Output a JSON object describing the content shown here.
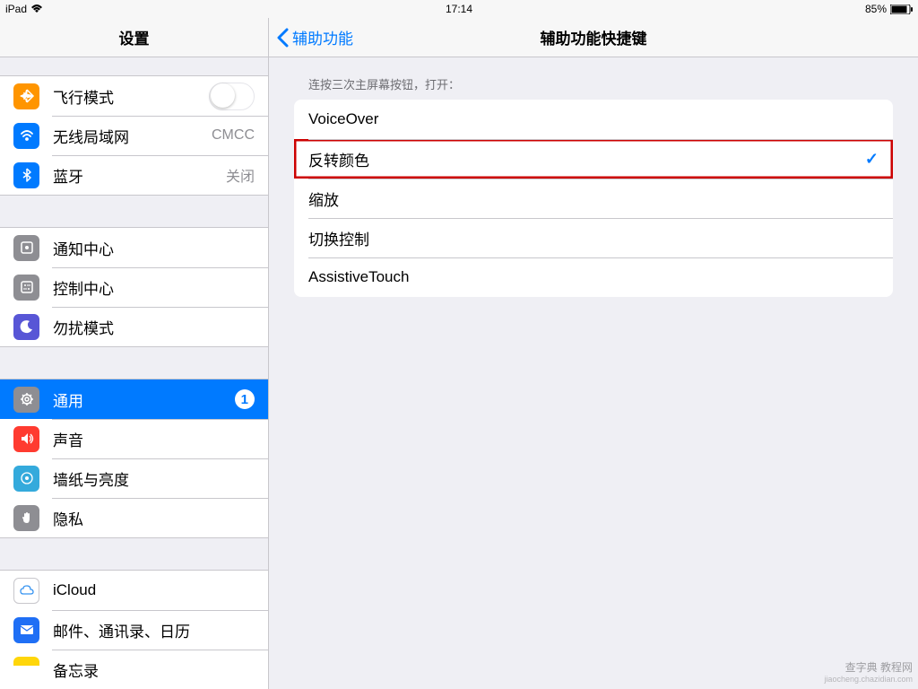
{
  "status": {
    "device": "iPad",
    "time": "17:14",
    "battery": "85%"
  },
  "sidebar": {
    "title": "设置",
    "groups": [
      [
        {
          "id": "airplane",
          "label": "飞行模式",
          "type": "toggle"
        },
        {
          "id": "wifi",
          "label": "无线局域网",
          "value": "CMCC"
        },
        {
          "id": "bluetooth",
          "label": "蓝牙",
          "value": "关闭"
        }
      ],
      [
        {
          "id": "notif",
          "label": "通知中心"
        },
        {
          "id": "control",
          "label": "控制中心"
        },
        {
          "id": "dnd",
          "label": "勿扰模式"
        }
      ],
      [
        {
          "id": "general",
          "label": "通用",
          "badge": "1",
          "selected": true
        },
        {
          "id": "sounds",
          "label": "声音"
        },
        {
          "id": "wallpaper",
          "label": "墙纸与亮度"
        },
        {
          "id": "privacy",
          "label": "隐私"
        }
      ],
      [
        {
          "id": "icloud",
          "label": "iCloud"
        },
        {
          "id": "mail",
          "label": "邮件、通讯录、日历"
        },
        {
          "id": "notes",
          "label": "备忘录"
        }
      ]
    ]
  },
  "main": {
    "back": "辅助功能",
    "title": "辅助功能快捷键",
    "section_header": "连按三次主屏幕按钮，打开：",
    "options": [
      {
        "label": "VoiceOver",
        "checked": false,
        "highlight": false
      },
      {
        "label": "反转颜色",
        "checked": true,
        "highlight": true
      },
      {
        "label": "缩放",
        "checked": false,
        "highlight": false
      },
      {
        "label": "切换控制",
        "checked": false,
        "highlight": false
      },
      {
        "label": "AssistiveTouch",
        "checked": false,
        "highlight": false
      }
    ]
  },
  "watermark": {
    "line1": "查字典 教程网",
    "line2": "jiaocheng.chazidian.com"
  }
}
